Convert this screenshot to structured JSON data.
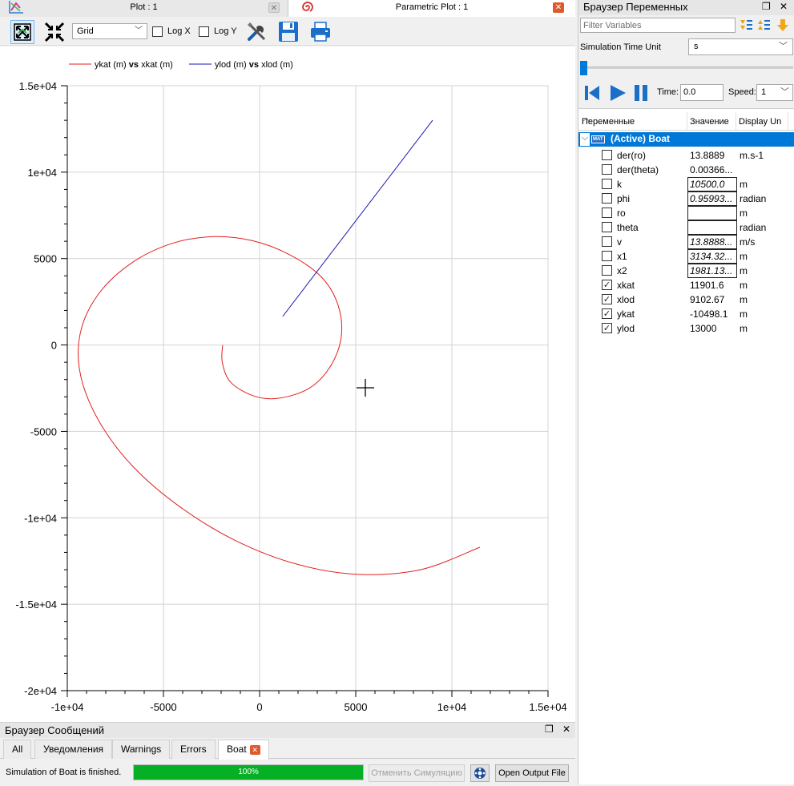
{
  "tabs": [
    {
      "title": "Plot : 1",
      "icon": "plot-icon",
      "active": false
    },
    {
      "title": "Parametric Plot : 1",
      "icon": "parametric-plot-icon",
      "active": true
    }
  ],
  "toolbar": {
    "grid_select": "Grid",
    "log_x": "Log X",
    "log_y": "Log Y"
  },
  "chart_data": {
    "type": "line",
    "title": "",
    "xlabel": "",
    "ylabel": "",
    "xlim": [
      -10000,
      15000
    ],
    "ylim": [
      -20000,
      15000
    ],
    "grid": true,
    "legend_position": "top-left",
    "x_ticks": [
      "-1e+04",
      "-5000",
      "0",
      "5000",
      "1e+04",
      "1.5e+04"
    ],
    "y_ticks": [
      "1.5e+04",
      "1e+04",
      "5000",
      "0",
      "-5000",
      "-1e+04",
      "-1.5e+04",
      "-2e+04"
    ],
    "legend": [
      {
        "y": "ykat (m)",
        "vs": "vs",
        "x": "xkat (m)",
        "color": "#e02020"
      },
      {
        "y": "ylod (m)",
        "vs": "vs",
        "x": "xlod (m)",
        "color": "#1818b0"
      }
    ],
    "series": [
      {
        "name": "ykat (m) vs xkat (m)",
        "color": "#e02020",
        "kind": "spiral",
        "x": [
          -1920,
          -1940,
          -1500,
          -300,
          1000,
          2600,
          3700,
          4250,
          4070,
          3200,
          1550,
          -350,
          -2360,
          -4540,
          -6690,
          -8410,
          -9330,
          -9300,
          -8340,
          -6580,
          -4100,
          -1190,
          2000,
          5260,
          8440,
          11460
        ],
        "y": [
          0,
          -1000,
          -2160,
          -2950,
          -3080,
          -2490,
          -1200,
          510,
          2340,
          3950,
          5230,
          6030,
          6270,
          5880,
          4720,
          2900,
          660,
          -1800,
          -4430,
          -7040,
          -9400,
          -11350,
          -12700,
          -13280,
          -12980,
          -11700
        ]
      },
      {
        "name": "ylod (m) vs xlod (m)",
        "color": "#1818b0",
        "kind": "line",
        "x": [
          1200,
          9000
        ],
        "y": [
          1650,
          13000
        ]
      }
    ]
  },
  "messages": {
    "title": "Браузер Сообщений",
    "tabs": [
      "All",
      "Уведомления",
      "Warnings",
      "Errors",
      "Boat"
    ],
    "status": "Simulation of Boat is finished.",
    "progress": 1.0,
    "progress_text": "100%",
    "cancel_button": "Отменить Симуляцию",
    "open_output": "Open Output File"
  },
  "variables": {
    "title": "Браузер Переменных",
    "filter_placeholder": "Filter Variables",
    "sim_time_unit_label": "Simulation Time Unit",
    "sim_time_unit": "s",
    "time_label": "Time:",
    "time_value": "0.0",
    "speed_label": "Speed:",
    "speed_value": "1",
    "columns": [
      "Переменные",
      "Значение",
      "Display Un"
    ],
    "root": {
      "badge": "MAT",
      "name": "(Active) Boat"
    },
    "rows": [
      {
        "name": "der(ro)",
        "value": "13.8889",
        "unit": "m.s-1",
        "checked": false,
        "editable": false
      },
      {
        "name": "der(theta)",
        "value": "0.00366...",
        "unit": "",
        "checked": false,
        "editable": false
      },
      {
        "name": "k",
        "value": "10500.0",
        "unit": "m",
        "checked": false,
        "editable": true
      },
      {
        "name": "phi",
        "value": "0.95993...",
        "unit": "radian",
        "checked": false,
        "editable": true
      },
      {
        "name": "ro",
        "value": "",
        "unit": "m",
        "checked": false,
        "editable": true
      },
      {
        "name": "theta",
        "value": "",
        "unit": "radian",
        "checked": false,
        "editable": true
      },
      {
        "name": "v",
        "value": "13.8888...",
        "unit": "m/s",
        "checked": false,
        "editable": true
      },
      {
        "name": "x1",
        "value": "3134.32...",
        "unit": "m",
        "checked": false,
        "editable": true
      },
      {
        "name": "x2",
        "value": "1981.13...",
        "unit": "m",
        "checked": false,
        "editable": true
      },
      {
        "name": "xkat",
        "value": "11901.6",
        "unit": "m",
        "checked": true,
        "editable": false
      },
      {
        "name": "xlod",
        "value": "9102.67",
        "unit": "m",
        "checked": true,
        "editable": false
      },
      {
        "name": "ykat",
        "value": "-10498.1",
        "unit": "m",
        "checked": true,
        "editable": false
      },
      {
        "name": "ylod",
        "value": "13000",
        "unit": "m",
        "checked": true,
        "editable": false
      }
    ]
  }
}
